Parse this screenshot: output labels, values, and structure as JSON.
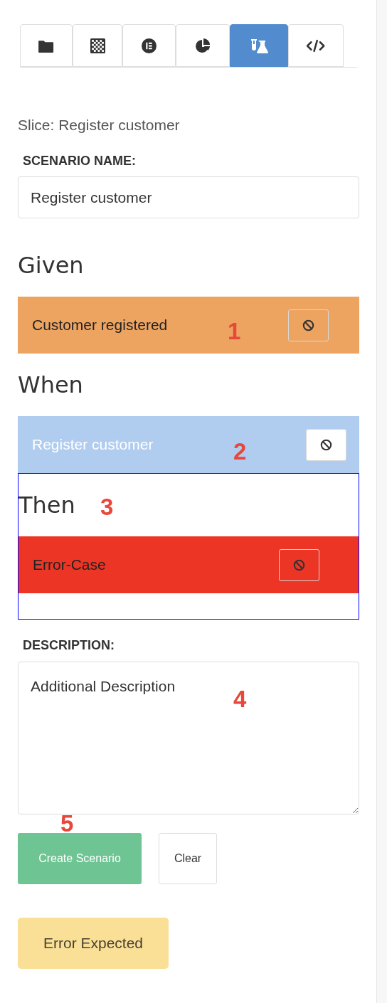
{
  "tabs": [
    {
      "kind": "folder",
      "selected": false
    },
    {
      "kind": "checkerboard",
      "selected": false
    },
    {
      "kind": "list-circle",
      "selected": false
    },
    {
      "kind": "pie",
      "selected": false
    },
    {
      "kind": "flask",
      "selected": true
    },
    {
      "kind": "code",
      "selected": false
    }
  ],
  "slice_label": "Slice: Register customer",
  "scenario_name": {
    "label": "SCENARIO NAME:",
    "value": "Register customer"
  },
  "sections": [
    {
      "heading": "Given",
      "selected": false,
      "items": [
        {
          "label": "Customer registered",
          "kind": "event",
          "marker": "1"
        }
      ]
    },
    {
      "heading": "When",
      "selected": false,
      "items": [
        {
          "label": "Register customer",
          "kind": "command",
          "marker": "2"
        }
      ]
    },
    {
      "heading": "Then",
      "selected": true,
      "marker": "3",
      "items": [
        {
          "label": "Error-Case",
          "kind": "error"
        }
      ]
    }
  ],
  "description": {
    "label": "DESCRIPTION:",
    "value": "Additional Description",
    "markers": [
      "4",
      "5"
    ]
  },
  "buttons": [
    {
      "label": "Create Scenario",
      "kind": "primary"
    },
    {
      "label": "Clear",
      "kind": "plain"
    }
  ],
  "status_badge": "Error Expected"
}
